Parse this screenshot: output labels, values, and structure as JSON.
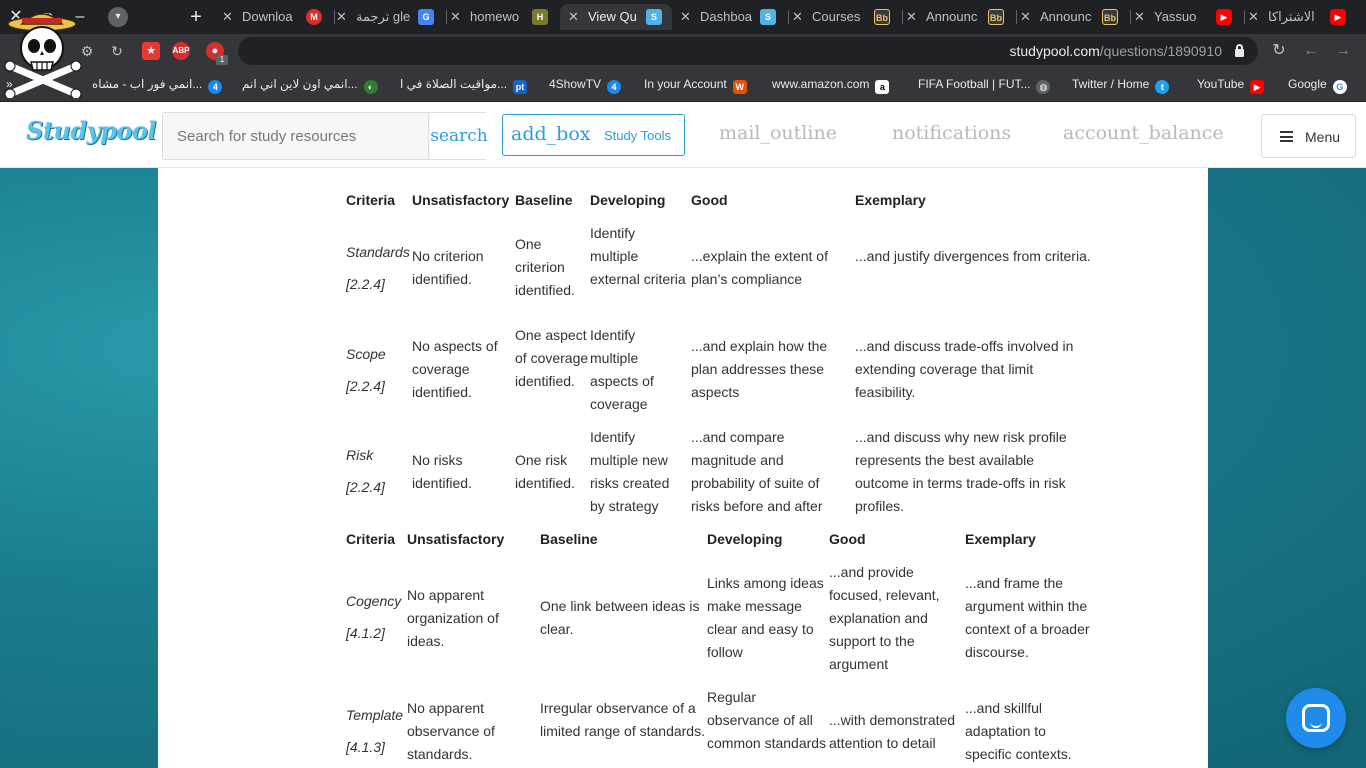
{
  "browser": {
    "tabs": [
      {
        "label": "Downloa",
        "fav": "M",
        "fav_color": "#d93025"
      },
      {
        "label": "ترجمة gle",
        "fav": "G",
        "fav_color": "#4285f4"
      },
      {
        "label": "homewo",
        "fav": "H",
        "fav_color": "#7a7a2a"
      },
      {
        "label": "View Qu",
        "fav": "S",
        "fav_color": "#4fb3e8"
      },
      {
        "label": "Dashboa",
        "fav": "S",
        "fav_color": "#4fb3e8"
      },
      {
        "label": "Courses",
        "fav": "Bb",
        "fav_color": "#3a3a3a"
      },
      {
        "label": "Announc",
        "fav": "Bb",
        "fav_color": "#3a3a3a"
      },
      {
        "label": "Announc",
        "fav": "Bb",
        "fav_color": "#3a3a3a"
      },
      {
        "label": "Yassuo",
        "fav": "▶",
        "fav_color": "#ff0000"
      },
      {
        "label": "الاشتراكا",
        "fav": "▶",
        "fav_color": "#ff0000"
      }
    ],
    "url_host": "studypool.com",
    "url_path": "/questions/1890910",
    "extension_badge": "1",
    "bookmarks": [
      {
        "label": "انمي فور اب - مشاه...",
        "fav": "4",
        "fav_color": "#1e88e5"
      },
      {
        "label": "انمي اون لاين اني انم...",
        "fav": "◐",
        "fav_color": "#2e7d32"
      },
      {
        "label": "مواقيت الصلاة في ا...",
        "fav": "pt",
        "fav_color": "#1565c0"
      },
      {
        "label": "4ShowTV",
        "fav": "4",
        "fav_color": "#1e88e5"
      },
      {
        "label": "In your Account",
        "fav": "W",
        "fav_color": "#e65100"
      },
      {
        "label": "www.amazon.com",
        "fav": "a",
        "fav_color": "#ffffff"
      },
      {
        "label": "FIFA Football | FUT...",
        "fav": "◍",
        "fav_color": "#9e9e9e"
      },
      {
        "label": "Twitter / Home",
        "fav": "t",
        "fav_color": "#1da1f2"
      },
      {
        "label": "YouTube",
        "fav": "▶",
        "fav_color": "#ff0000"
      },
      {
        "label": "Google",
        "fav": "G",
        "fav_color": "#4285f4"
      }
    ]
  },
  "site": {
    "logo": "Studypool",
    "search_placeholder": "Search for study resources",
    "search_label": "search",
    "study_tools_icon": "add_box",
    "study_tools_label": "Study Tools",
    "mail_icon": "mail_outline",
    "notifications_icon": "notifications",
    "balance_icon": "account_balance",
    "menu_label": "Menu",
    "brand_color": "#2a9fd6"
  },
  "rubric1": {
    "headers": [
      "Criteria",
      "Unsatisfactory",
      "Baseline",
      "Developing",
      "Good",
      "Exemplary"
    ],
    "rows": [
      {
        "criteria": "Standards",
        "ref": "[2.2.4]",
        "cells": [
          "No criterion identified.",
          "One criterion identified.",
          "Identify multiple external criteria",
          "...explain the extent of plan’s compliance",
          "...and justify divergences from criteria."
        ]
      },
      {
        "criteria": "Scope",
        "ref": "[2.2.4]",
        "cells": [
          "No aspects of coverage identified.",
          "One aspect of coverage identified.",
          "Identify multiple aspects of coverage",
          "...and explain how the plan addresses these aspects",
          "...and discuss trade-offs involved in extending coverage that limit feasibility."
        ]
      },
      {
        "criteria": "Risk",
        "ref": "[2.2.4]",
        "cells": [
          "No risks identified.",
          "One risk identified.",
          "Identify multiple new risks created by strategy",
          "...and compare magnitude and probability of suite of risks before and after",
          "...and discuss why new risk profile represents the best available outcome in terms trade-offs in risk profiles."
        ]
      }
    ]
  },
  "rubric2": {
    "headers": [
      "Criteria",
      "Unsatisfactory",
      "Baseline",
      "Developing",
      "Good",
      "Exemplary"
    ],
    "rows": [
      {
        "criteria": "Cogency",
        "ref": "[4.1.2]",
        "cells": [
          "No apparent organization of ideas.",
          "One link between ideas is clear.",
          "Links among ideas make message clear and easy to follow",
          "...and provide focused, relevant, explanation and support to the argument",
          "...and frame the argument within the context of a broader discourse."
        ]
      },
      {
        "criteria": "Template",
        "ref": "[4.1.3]",
        "cells": [
          "No apparent observance of standards.",
          "Irregular observance of a limited range of standards.",
          "Regular observance of all common standards",
          "...with demonstrated attention to detail",
          "...and skillful adaptation to specific contexts."
        ]
      }
    ]
  }
}
